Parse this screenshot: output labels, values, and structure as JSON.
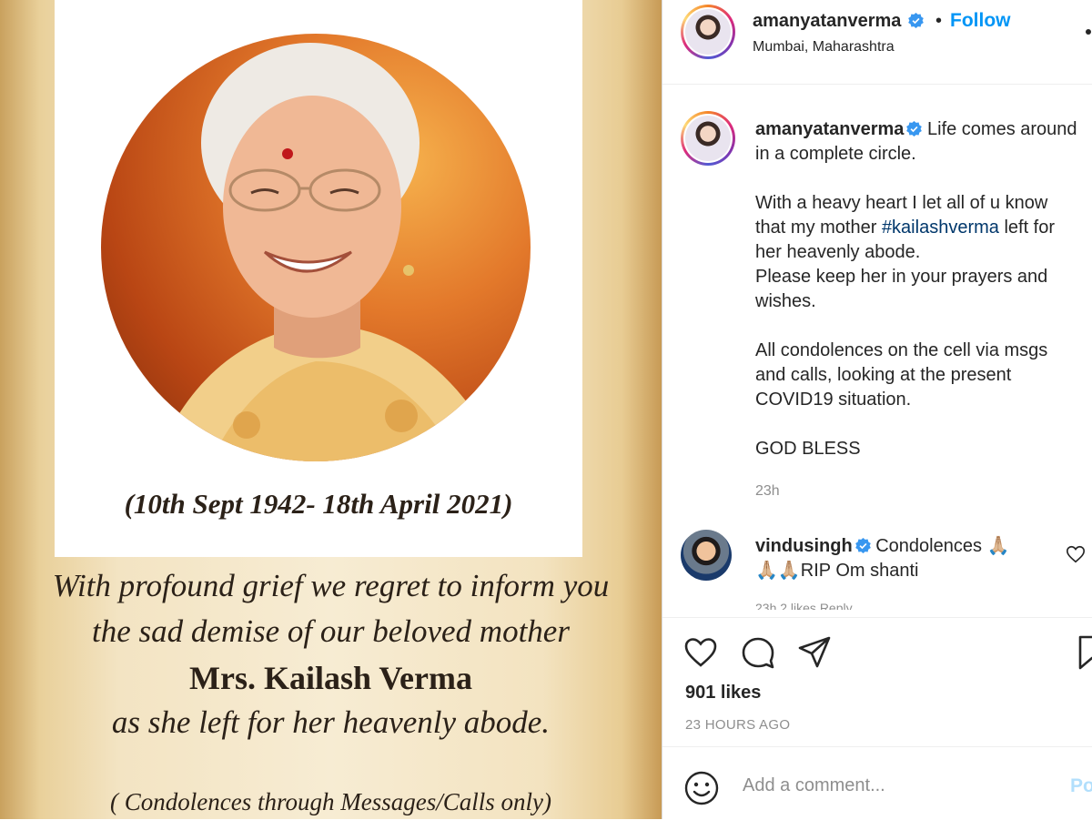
{
  "image": {
    "dates": "(10th Sept 1942- 18th April 2021)",
    "memo_line1": "With profound grief we regret to inform you",
    "memo_line2": "the sad demise of our beloved mother",
    "memo_name": "Mrs. Kailash Verma",
    "memo_line4": "as she left for her heavenly abode.",
    "memo_footer": "( Condolences through Messages/Calls only)"
  },
  "header": {
    "username": "amanyatanverma",
    "dot": "•",
    "follow_label": "Follow",
    "location": "Mumbai, Maharashtra"
  },
  "caption": {
    "username": "amanyatanverma",
    "line1": "Life comes around in a complete circle.",
    "para2_before": "With a heavy heart I let all of u know that my mother ",
    "hashtag": "#kailashverma",
    "para2_after": " left for her heavenly abode.",
    "para3": "Please keep her in your prayers and wishes.",
    "para4": "All condolences on the cell via msgs and calls, looking at the present COVID19 situation.",
    "para5": "GOD BLESS",
    "time": "23h"
  },
  "comment": {
    "username": "vindusingh",
    "text": "Condolences 🙏🏼 🙏🏼🙏🏼RIP Om shanti",
    "meta": "23h   2 likes   Reply"
  },
  "stats": {
    "likes": "901 likes",
    "posted": "23 HOURS AGO"
  },
  "comment_box": {
    "placeholder": "Add a comment...",
    "post_label": "Po"
  },
  "colors": {
    "accent": "#0095f6",
    "verified": "#3897f0",
    "hashtag": "#00376b",
    "muted": "#8e8e8e"
  }
}
